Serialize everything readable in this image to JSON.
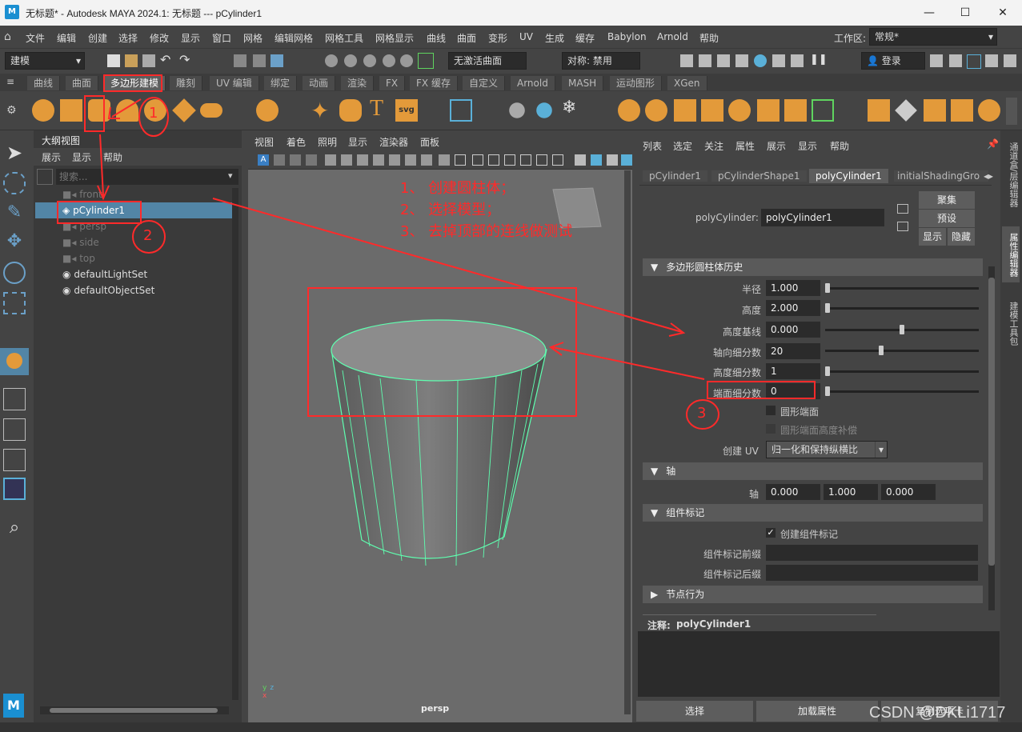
{
  "window": {
    "title": "无标题* - Autodesk MAYA 2024.1: 无标题   ---   pCylinder1",
    "logo": "M",
    "minimize": "—",
    "maximize": "☐",
    "close": "✕"
  },
  "menubar": {
    "items": [
      "文件",
      "编辑",
      "创建",
      "选择",
      "修改",
      "显示",
      "窗口",
      "网格",
      "编辑网格",
      "网格工具",
      "网格显示",
      "曲线",
      "曲面",
      "变形",
      "UV",
      "生成",
      "缓存",
      "Babylon",
      "Arnold",
      "帮助"
    ],
    "workspace_label": "工作区:",
    "workspace_value": "常规*"
  },
  "statusline": {
    "mode": "建模",
    "live_surface": "无激活曲面",
    "symmetry": "对称: 禁用",
    "login": "登录"
  },
  "shelf": {
    "tabs": [
      "曲线",
      "曲面",
      "多边形建模",
      "雕刻",
      "UV 编辑",
      "绑定",
      "动画",
      "渲染",
      "FX",
      "FX 缓存",
      "自定义",
      "Arnold",
      "MASH",
      "运动图形",
      "XGen"
    ],
    "active_tab": "多边形建模",
    "gear": "⚙",
    "menu": "≡"
  },
  "outliner": {
    "title": "大纲视图",
    "menu": [
      "展示",
      "显示",
      "帮助"
    ],
    "search_placeholder": "搜索...",
    "items": [
      {
        "label": "front",
        "dim": true
      },
      {
        "label": "pCylinder1",
        "selected": true
      },
      {
        "label": "persp",
        "dim": true
      },
      {
        "label": "side",
        "dim": true
      },
      {
        "label": "top",
        "dim": true
      },
      {
        "label": "defaultLightSet"
      },
      {
        "label": "defaultObjectSet"
      }
    ]
  },
  "viewport": {
    "menu": [
      "视图",
      "着色",
      "照明",
      "显示",
      "渲染器",
      "面板"
    ],
    "camera_label": "persp",
    "annotation_lines": [
      "1、 创建圆柱体；",
      "2、 选择模型；",
      "3、 去掉顶部的连线做测试"
    ],
    "anno_1": "1",
    "anno_2": "2",
    "anno_3": "3",
    "axis_labels": {
      "x": "x",
      "y": "y",
      "z": "z"
    }
  },
  "attribute_editor": {
    "menu": [
      "列表",
      "选定",
      "关注",
      "属性",
      "展示",
      "显示",
      "帮助"
    ],
    "tabs": [
      "pCylinder1",
      "pCylinderShape1",
      "polyCylinder1",
      "initialShadingGro"
    ],
    "active_tab": "polyCylinder1",
    "node_label": "polyCylinder:",
    "node_value": "polyCylinder1",
    "btn_focus": "聚集",
    "btn_preset": "预设",
    "btn_show": "显示",
    "btn_hide": "隐藏",
    "section_history": "多边形圆柱体历史",
    "fields": [
      {
        "label": "半径",
        "value": "1.000",
        "slider": 0.0
      },
      {
        "label": "高度",
        "value": "2.000",
        "slider": 0.0
      },
      {
        "label": "高度基线",
        "value": "0.000",
        "slider": 0.5
      },
      {
        "label": "轴向细分数",
        "value": "20",
        "slider": 0.36
      },
      {
        "label": "高度细分数",
        "value": "1",
        "slider": 0.0
      },
      {
        "label": "端面细分数",
        "value": "0",
        "slider": 0.0
      }
    ],
    "check_round_cap": "圆形端面",
    "check_round_cap_height": "圆形端面高度补偿",
    "create_uv_label": "创建 UV",
    "create_uv_value": "归一化和保持纵横比",
    "section_axis": "轴",
    "axis_label": "轴",
    "axis_values": [
      "0.000",
      "1.000",
      "0.000"
    ],
    "section_component": "组件标记",
    "check_create_component": "创建组件标记",
    "component_prefix_label": "组件标记前缀",
    "component_suffix_label": "组件标记后缀",
    "section_node": "节点行为",
    "notes_label": "注释:",
    "notes_value": "polyCylinder1",
    "bottom_buttons": [
      "选择",
      "加载属性",
      "复制选项卡"
    ]
  },
  "side_tabs": [
    "通道盒/层编辑器",
    "属性编辑器",
    "建模工具包"
  ],
  "watermark": "CSDN @DKLi1717",
  "colors": {
    "accent_selected": "#5285a6",
    "annotation": "#ff2a2a",
    "wire": "#5fffb0",
    "active_tab": "#5d5d5d"
  }
}
